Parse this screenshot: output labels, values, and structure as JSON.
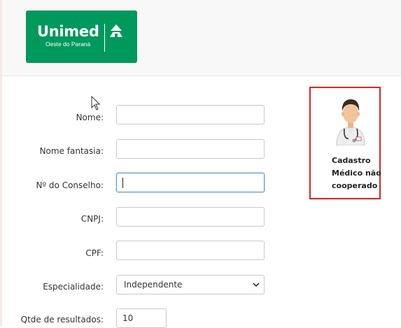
{
  "header": {
    "logo": {
      "brand": "Unimed",
      "region": "Oeste do Paraná"
    }
  },
  "form": {
    "nome": {
      "label": "Nome:",
      "value": ""
    },
    "nome_fantasia": {
      "label": "Nome fantasia:",
      "value": ""
    },
    "conselho": {
      "label": "Nº do Conselho:",
      "value": ""
    },
    "cnpj": {
      "label": "CNPJ:",
      "value": ""
    },
    "cpf": {
      "label": "CPF:",
      "value": ""
    },
    "especialidade": {
      "label": "Especialidade:",
      "selected": "Independente"
    },
    "qtde": {
      "label": "Qtde de resultados:",
      "value": "10"
    }
  },
  "card": {
    "line1": "Cadastro",
    "line2": "Médico não",
    "line3": "cooperado",
    "icon": "doctor-avatar-icon"
  },
  "colors": {
    "brand_green": "#00995d",
    "highlight_red": "#d42a2a",
    "focus_blue": "#5b9bd5"
  }
}
